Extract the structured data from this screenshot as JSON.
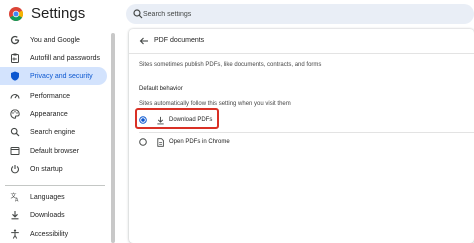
{
  "header": {
    "title": "Settings",
    "search_placeholder": "Search settings"
  },
  "sidebar": {
    "items": [
      {
        "label": "You and Google",
        "icon": "google-g-icon"
      },
      {
        "label": "Autofill and passwords",
        "icon": "clipboard-key-icon"
      },
      {
        "label": "Privacy and security",
        "icon": "shield-icon",
        "selected": true
      },
      {
        "label": "Performance",
        "icon": "speedometer-icon"
      },
      {
        "label": "Appearance",
        "icon": "palette-icon"
      },
      {
        "label": "Search engine",
        "icon": "search-icon"
      },
      {
        "label": "Default browser",
        "icon": "browser-window-icon"
      },
      {
        "label": "On startup",
        "icon": "power-icon"
      },
      {
        "label": "Languages",
        "icon": "translate-icon"
      },
      {
        "label": "Downloads",
        "icon": "download-icon"
      },
      {
        "label": "Accessibility",
        "icon": "accessibility-icon"
      }
    ]
  },
  "page": {
    "title": "PDF documents",
    "description": "Sites sometimes publish PDFs, like documents, contracts, and forms",
    "section_heading": "Default behavior",
    "section_sub": "Sites automatically follow this setting when you visit them",
    "options": [
      {
        "label": "Download PDFs",
        "icon": "download-icon",
        "selected": true
      },
      {
        "label": "Open PDFs in Chrome",
        "icon": "document-icon",
        "selected": false
      }
    ]
  },
  "colors": {
    "accent": "#0b57d0",
    "selected_bg": "#d3e3fd",
    "highlight": "#d93025",
    "search_bg": "#e9eef6"
  }
}
